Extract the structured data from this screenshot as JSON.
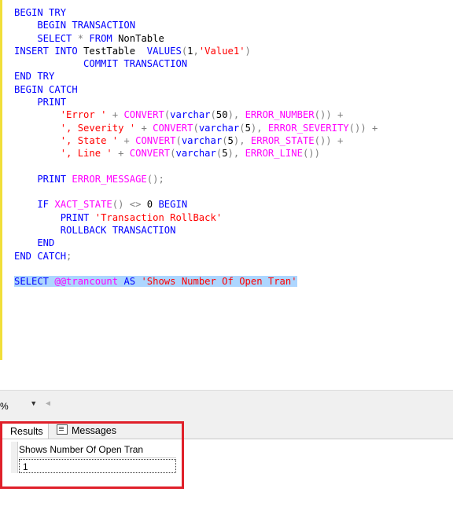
{
  "editor": {
    "lines": [
      [
        {
          "c": "kw",
          "t": "BEGIN TRY"
        }
      ],
      [
        {
          "c": "kw",
          "t": "    BEGIN TRANSACTION"
        }
      ],
      [
        {
          "c": "kw",
          "t": "    SELECT "
        },
        {
          "c": "op",
          "t": "* "
        },
        {
          "c": "kw",
          "t": "FROM "
        },
        {
          "c": "txt",
          "t": "NonTable"
        }
      ],
      [
        {
          "c": "kw",
          "t": "INSERT INTO "
        },
        {
          "c": "txt",
          "t": "TestTable  "
        },
        {
          "c": "kw",
          "t": "VALUES"
        },
        {
          "c": "op",
          "t": "("
        },
        {
          "c": "txt",
          "t": "1"
        },
        {
          "c": "op",
          "t": ","
        },
        {
          "c": "str",
          "t": "'Value1'"
        },
        {
          "c": "op",
          "t": ")"
        }
      ],
      [
        {
          "c": "kw",
          "t": "            COMMIT TRANSACTION"
        }
      ],
      [
        {
          "c": "kw",
          "t": "END TRY"
        }
      ],
      [
        {
          "c": "kw",
          "t": "BEGIN CATCH"
        }
      ],
      [
        {
          "c": "kw",
          "t": "    PRINT"
        }
      ],
      [
        {
          "c": "txt",
          "t": "        "
        },
        {
          "c": "str",
          "t": "'Error ' "
        },
        {
          "c": "op",
          "t": "+ "
        },
        {
          "c": "fn",
          "t": "CONVERT"
        },
        {
          "c": "op",
          "t": "("
        },
        {
          "c": "kw",
          "t": "varchar"
        },
        {
          "c": "op",
          "t": "("
        },
        {
          "c": "txt",
          "t": "50"
        },
        {
          "c": "op",
          "t": "), "
        },
        {
          "c": "fn",
          "t": "ERROR_NUMBER"
        },
        {
          "c": "op",
          "t": "()) +"
        }
      ],
      [
        {
          "c": "txt",
          "t": "        "
        },
        {
          "c": "str",
          "t": "', Severity ' "
        },
        {
          "c": "op",
          "t": "+ "
        },
        {
          "c": "fn",
          "t": "CONVERT"
        },
        {
          "c": "op",
          "t": "("
        },
        {
          "c": "kw",
          "t": "varchar"
        },
        {
          "c": "op",
          "t": "("
        },
        {
          "c": "txt",
          "t": "5"
        },
        {
          "c": "op",
          "t": "), "
        },
        {
          "c": "fn",
          "t": "ERROR_SEVERITY"
        },
        {
          "c": "op",
          "t": "()) +"
        }
      ],
      [
        {
          "c": "txt",
          "t": "        "
        },
        {
          "c": "str",
          "t": "', State ' "
        },
        {
          "c": "op",
          "t": "+ "
        },
        {
          "c": "fn",
          "t": "CONVERT"
        },
        {
          "c": "op",
          "t": "("
        },
        {
          "c": "kw",
          "t": "varchar"
        },
        {
          "c": "op",
          "t": "("
        },
        {
          "c": "txt",
          "t": "5"
        },
        {
          "c": "op",
          "t": "), "
        },
        {
          "c": "fn",
          "t": "ERROR_STATE"
        },
        {
          "c": "op",
          "t": "()) +"
        }
      ],
      [
        {
          "c": "txt",
          "t": "        "
        },
        {
          "c": "str",
          "t": "', Line ' "
        },
        {
          "c": "op",
          "t": "+ "
        },
        {
          "c": "fn",
          "t": "CONVERT"
        },
        {
          "c": "op",
          "t": "("
        },
        {
          "c": "kw",
          "t": "varchar"
        },
        {
          "c": "op",
          "t": "("
        },
        {
          "c": "txt",
          "t": "5"
        },
        {
          "c": "op",
          "t": "), "
        },
        {
          "c": "fn",
          "t": "ERROR_LINE"
        },
        {
          "c": "op",
          "t": "())"
        }
      ],
      [
        {
          "c": "txt",
          "t": " "
        }
      ],
      [
        {
          "c": "kw",
          "t": "    PRINT "
        },
        {
          "c": "fn",
          "t": "ERROR_MESSAGE"
        },
        {
          "c": "op",
          "t": "();"
        }
      ],
      [
        {
          "c": "txt",
          "t": " "
        }
      ],
      [
        {
          "c": "kw",
          "t": "    IF "
        },
        {
          "c": "fn",
          "t": "XACT_STATE"
        },
        {
          "c": "op",
          "t": "() <> "
        },
        {
          "c": "txt",
          "t": "0 "
        },
        {
          "c": "kw",
          "t": "BEGIN"
        }
      ],
      [
        {
          "c": "kw",
          "t": "        PRINT "
        },
        {
          "c": "str",
          "t": "'Transaction RollBack'"
        }
      ],
      [
        {
          "c": "kw",
          "t": "        ROLLBACK TRANSACTION"
        }
      ],
      [
        {
          "c": "kw",
          "t": "    END"
        }
      ],
      [
        {
          "c": "kw",
          "t": "END CATCH"
        },
        {
          "c": "op",
          "t": ";"
        }
      ],
      [
        {
          "c": "txt",
          "t": " "
        }
      ],
      [
        {
          "c": "kw sel",
          "t": "SELECT "
        },
        {
          "c": "fn sel",
          "t": "@@trancount "
        },
        {
          "c": "kw sel",
          "t": "AS "
        },
        {
          "c": "str sel",
          "t": "'Shows Number Of Open Tran'"
        }
      ]
    ]
  },
  "statusbar": {
    "zoom_label": "%",
    "dropdown_icon": "chevron-down-icon",
    "scroll_left_icon": "arrow-left-icon"
  },
  "results": {
    "tab_results_label": "Results",
    "tab_messages_label": "Messages",
    "column_header": "Shows Number Of Open Tran",
    "cell_value": "1"
  },
  "colors": {
    "keyword": "#0000ff",
    "string": "#ff0000",
    "function": "#ff00ff",
    "selection": "#add6ff",
    "highlight_box": "#e0202a"
  }
}
